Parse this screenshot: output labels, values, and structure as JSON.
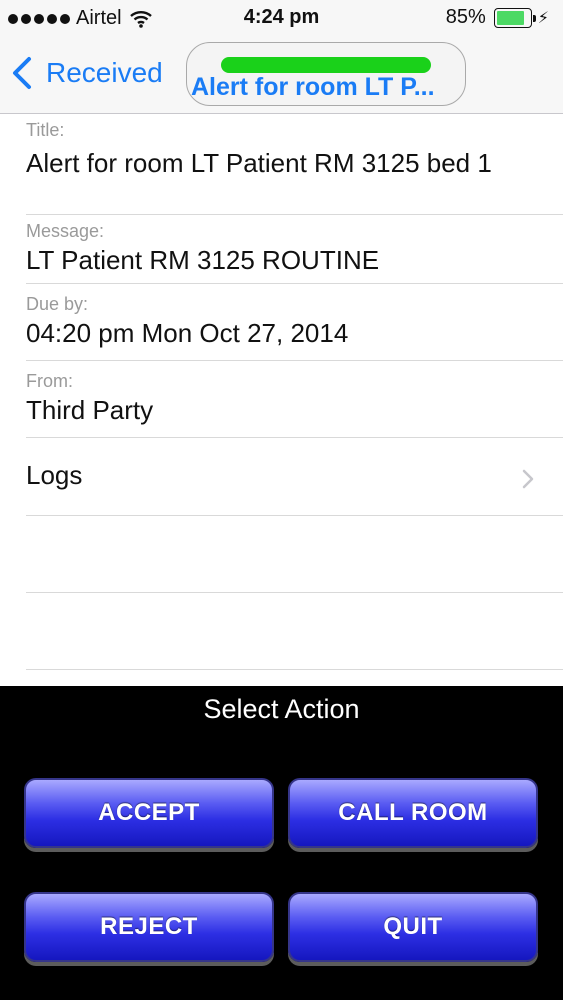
{
  "status_bar": {
    "carrier": "Airtel",
    "time": "4:24 pm",
    "battery_percent": "85%",
    "battery_level": 0.85,
    "icons": [
      "signal-dots-icon",
      "wifi-icon",
      "battery-icon",
      "charging-bolt-icon"
    ]
  },
  "nav": {
    "back_label": "Received",
    "title": "Alert for room LT P...",
    "title_indicator_color": "#1ad11a"
  },
  "fields": {
    "title_label": "Title:",
    "title_value": "Alert for room LT Patient RM 3125 bed 1",
    "message_label": "Message:",
    "message_value": "LT Patient RM 3125 ROUTINE",
    "due_label": "Due by:",
    "due_value": "04:20 pm Mon Oct 27, 2014",
    "from_label": "From:",
    "from_value": "Third Party",
    "logs_label": "Logs"
  },
  "actions": {
    "title": "Select Action",
    "accept": "ACCEPT",
    "call_room": "CALL ROOM",
    "reject": "REJECT",
    "quit": "QUIT"
  },
  "colors": {
    "accent": "#1a7cf5",
    "button": "#2d2fe4",
    "panel": "#000000"
  }
}
